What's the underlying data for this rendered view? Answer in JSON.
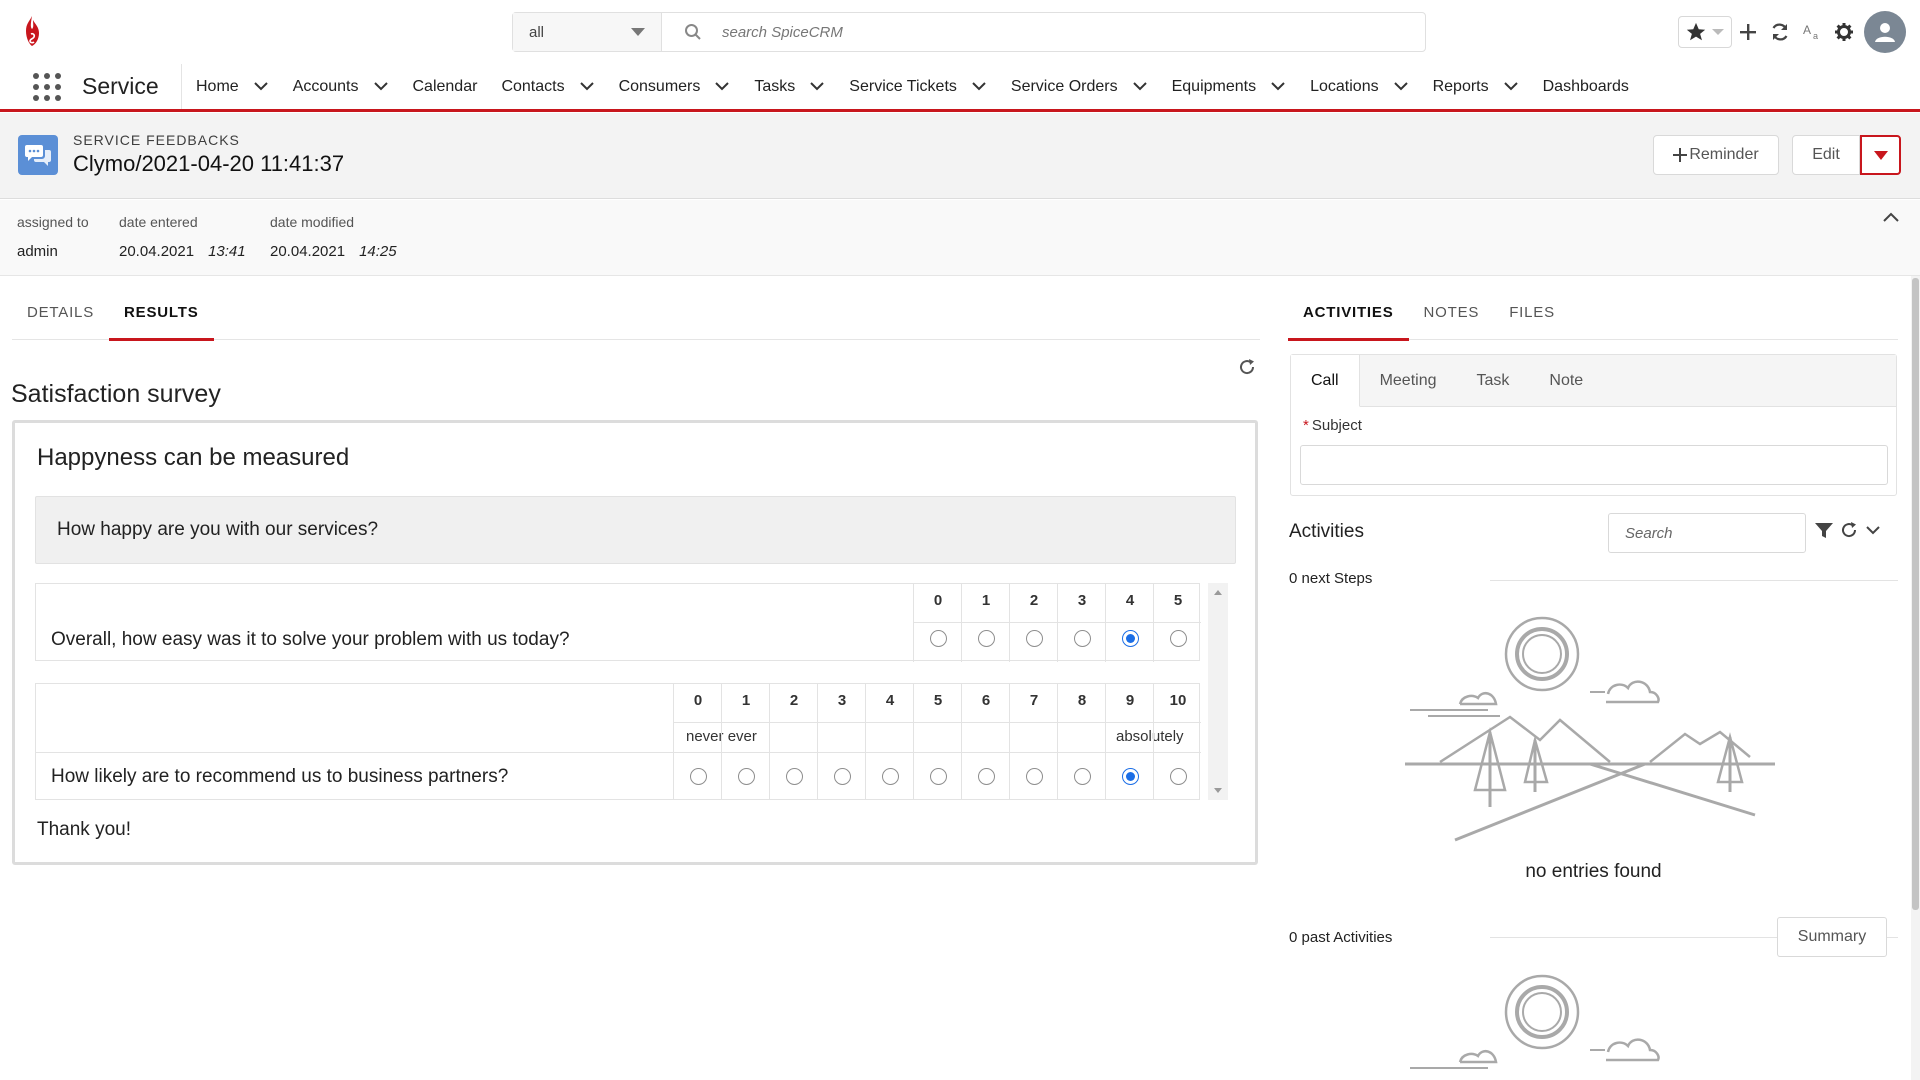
{
  "header": {
    "search_scope": "all",
    "search_placeholder": "search SpiceCRM"
  },
  "nav": {
    "app_name": "Service",
    "items": [
      {
        "label": "Home",
        "dropdown": true
      },
      {
        "label": "Accounts",
        "dropdown": true
      },
      {
        "label": "Calendar",
        "dropdown": false
      },
      {
        "label": "Contacts",
        "dropdown": true
      },
      {
        "label": "Consumers",
        "dropdown": true
      },
      {
        "label": "Tasks",
        "dropdown": true
      },
      {
        "label": "Service Tickets",
        "dropdown": true
      },
      {
        "label": "Service Orders",
        "dropdown": true
      },
      {
        "label": "Equipments",
        "dropdown": true
      },
      {
        "label": "Locations",
        "dropdown": true
      },
      {
        "label": "Reports",
        "dropdown": true
      },
      {
        "label": "Dashboards",
        "dropdown": false
      }
    ]
  },
  "record": {
    "type": "SERVICE FEEDBACKS",
    "title": "Clymo/2021-04-20 11:41:37",
    "reminder_label": "Reminder",
    "edit_label": "Edit"
  },
  "highlights": {
    "assigned_to_label": "assigned to",
    "assigned_to": "admin",
    "date_entered_label": "date entered",
    "date_entered_date": "20.04.2021",
    "date_entered_time": "13:41",
    "date_modified_label": "date modified",
    "date_modified_date": "20.04.2021",
    "date_modified_time": "14:25"
  },
  "main_tabs": [
    {
      "label": "DETAILS",
      "active": false
    },
    {
      "label": "RESULTS",
      "active": true
    }
  ],
  "survey": {
    "title": "Satisfaction survey",
    "heading": "Happyness can be measured",
    "section_question": "How happy are you with our services?",
    "q1": {
      "text": "Overall, how easy was it to solve your problem with us today?",
      "scale": [
        "0",
        "1",
        "2",
        "3",
        "4",
        "5"
      ],
      "selected": 4
    },
    "q2": {
      "text": "How likely are to recommend us to business partners?",
      "scale": [
        "0",
        "1",
        "2",
        "3",
        "4",
        "5",
        "6",
        "7",
        "8",
        "9",
        "10"
      ],
      "low_label": "never ever",
      "high_label": "absolutely",
      "selected": 9
    },
    "closing": "Thank you!"
  },
  "side_tabs": [
    {
      "label": "ACTIVITIES",
      "active": true
    },
    {
      "label": "NOTES",
      "active": false
    },
    {
      "label": "FILES",
      "active": false
    }
  ],
  "composer": {
    "tabs": [
      "Call",
      "Meeting",
      "Task",
      "Note"
    ],
    "active_tab": "Call",
    "subject_label": "Subject"
  },
  "activities": {
    "title": "Activities",
    "search_placeholder": "Search",
    "next_steps": "0 next Steps",
    "empty_text": "no entries found",
    "past": "0 past Activities",
    "summary_label": "Summary"
  },
  "colors": {
    "accent": "#c8161d",
    "radio_selected": "#1b6ee6",
    "module_icon": "#5b8fd6"
  }
}
